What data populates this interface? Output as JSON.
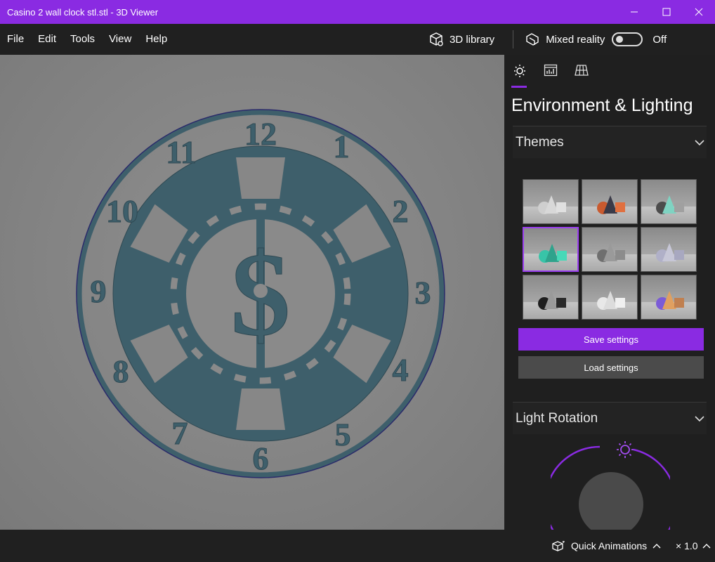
{
  "window": {
    "title": "Casino 2 wall clock stl.stl - 3D Viewer",
    "accent_color": "#8a2be2"
  },
  "menu": {
    "items": [
      {
        "label": "File"
      },
      {
        "label": "Edit"
      },
      {
        "label": "Tools"
      },
      {
        "label": "View"
      },
      {
        "label": "Help"
      }
    ],
    "library_label": "3D library",
    "mixed_reality_label": "Mixed reality",
    "mixed_reality_state": "Off"
  },
  "viewport": {
    "model_color": "#3e5f6b",
    "clock_numbers": [
      "12",
      "1",
      "2",
      "3",
      "4",
      "5",
      "6",
      "7",
      "8",
      "9",
      "10",
      "11"
    ],
    "center_symbol": "$"
  },
  "panel": {
    "tabs": [
      {
        "icon": "sun-icon",
        "active": true
      },
      {
        "icon": "stats-icon",
        "active": false
      },
      {
        "icon": "grid-icon",
        "active": false
      }
    ],
    "title": "Environment & Lighting",
    "themes_label": "Themes",
    "themes": [
      {
        "colors": [
          "#cfcfcf",
          "#d8d8d8",
          "#e0e0e0"
        ],
        "selected": false
      },
      {
        "colors": [
          "#c95a2f",
          "#3a3a48",
          "#e07040"
        ],
        "selected": false
      },
      {
        "colors": [
          "#4c4c4c",
          "#7fd3c2",
          "#a0a0a0"
        ],
        "selected": false
      },
      {
        "colors": [
          "#38c4a8",
          "#2fa38c",
          "#48d9b8"
        ],
        "selected": true
      },
      {
        "colors": [
          "#6f6f6f",
          "#9a9a9a",
          "#8c8c8c"
        ],
        "selected": false
      },
      {
        "colors": [
          "#b0b0c8",
          "#c7c7d7",
          "#a8a8c0"
        ],
        "selected": false
      },
      {
        "colors": [
          "#1e1e1e",
          "#9a9a9a",
          "#2a2a2a"
        ],
        "selected": false
      },
      {
        "colors": [
          "#e8e8e8",
          "#dcdcdc",
          "#f0f0f0"
        ],
        "selected": false
      },
      {
        "colors": [
          "#7b5bd6",
          "#e0a060",
          "#c08050"
        ],
        "selected": false
      }
    ],
    "save_label": "Save settings",
    "load_label": "Load settings",
    "light_rotation_label": "Light Rotation"
  },
  "status": {
    "quick_animations_label": "Quick Animations",
    "zoom": "× 1.0"
  }
}
